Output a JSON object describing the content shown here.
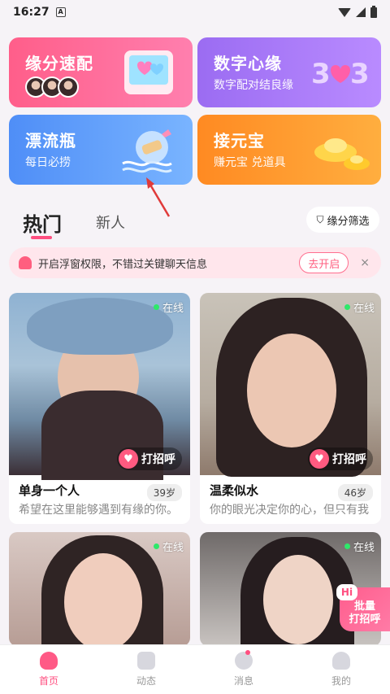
{
  "status": {
    "time": "16:27",
    "badge": "A"
  },
  "cards": [
    {
      "title": "缘分速配",
      "sub": ""
    },
    {
      "title": "数字心缘",
      "sub": "数字配对结良缘"
    },
    {
      "title": "漂流瓶",
      "sub": "每日必捞"
    },
    {
      "title": "接元宝",
      "sub": "赚元宝 兑道具"
    }
  ],
  "tabs": {
    "hot": "热门",
    "new": "新人"
  },
  "filter": {
    "label": "缘分筛选"
  },
  "notice": {
    "text": "开启浮窗权限，不错过关键聊天信息",
    "button": "去开启",
    "close": "×"
  },
  "profiles": [
    {
      "online": "在线",
      "greet": "打招呼",
      "name": "单身一个人",
      "age": "39岁",
      "bio": "希望在这里能够遇到有缘的你。"
    },
    {
      "online": "在线",
      "greet": "打招呼",
      "name": "温柔似水",
      "age": "46岁",
      "bio": "你的眼光决定你的心，但只有我"
    },
    {
      "online": "在线"
    },
    {
      "online": "在线"
    }
  ],
  "batch": {
    "hi": "Hi",
    "line1": "批量",
    "line2": "打招呼"
  },
  "nav": [
    {
      "label": "首页",
      "active": true
    },
    {
      "label": "动态"
    },
    {
      "label": "消息"
    },
    {
      "label": "我的"
    }
  ],
  "colors": {
    "accent": "#ff4f80",
    "online": "#2ee86a"
  }
}
